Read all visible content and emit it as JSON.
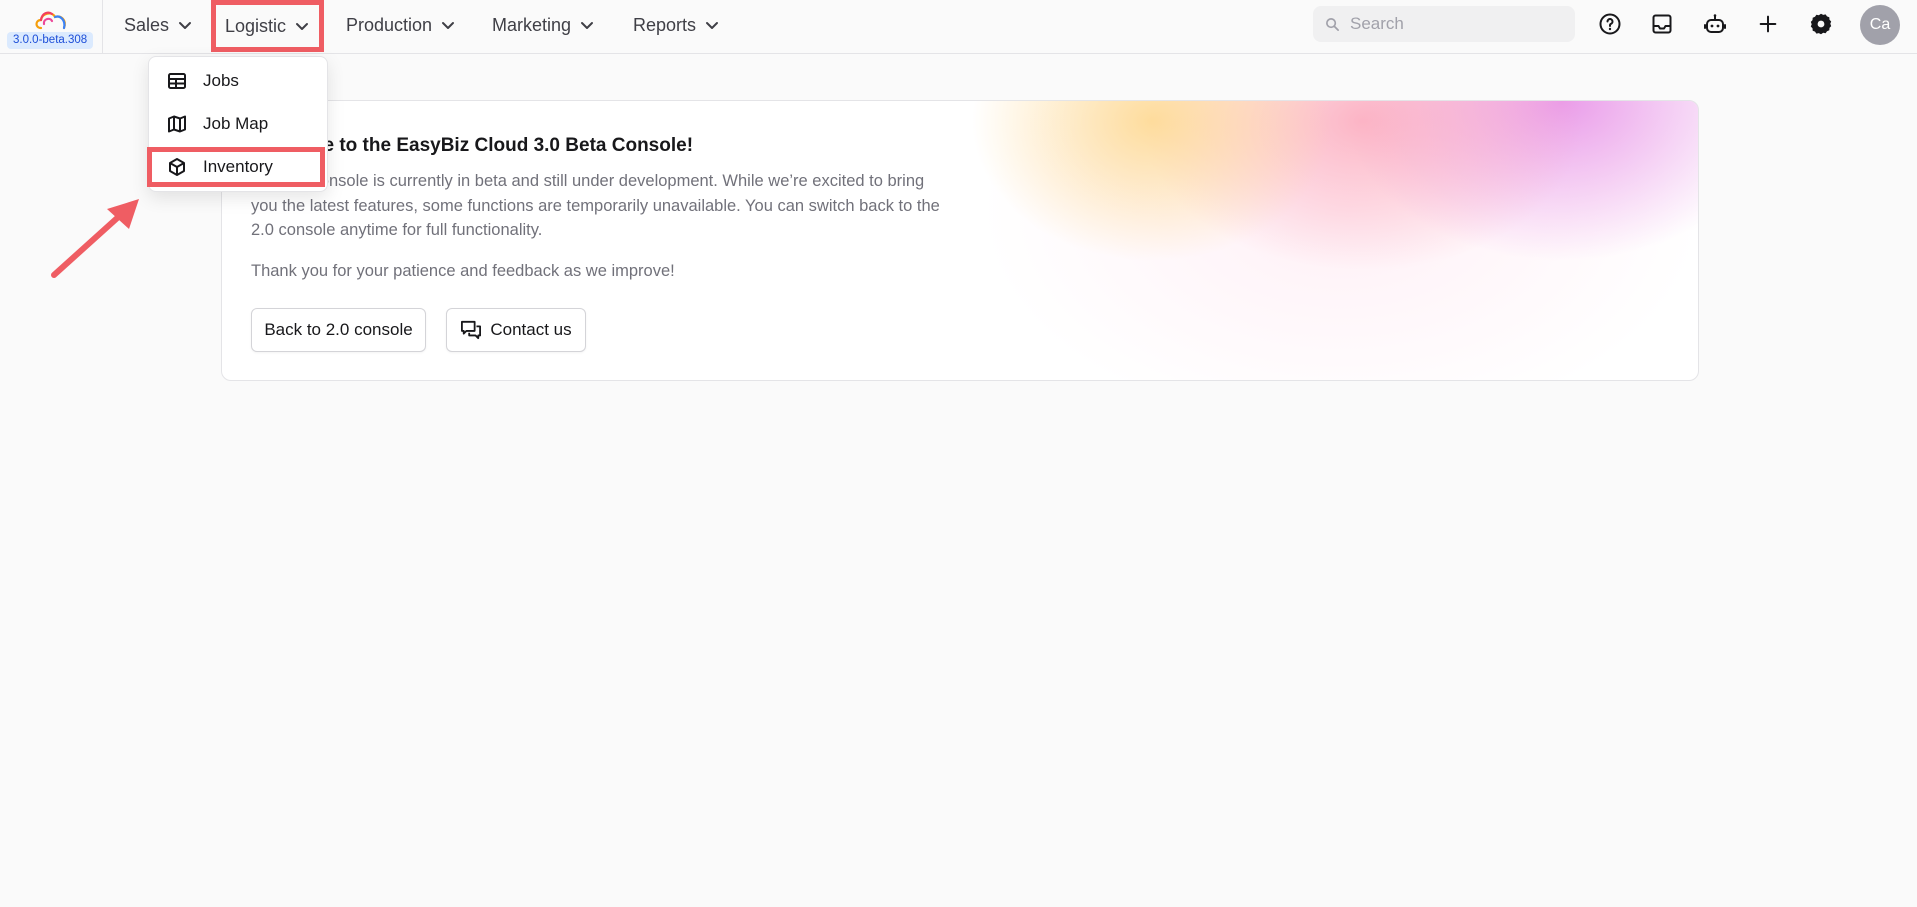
{
  "app": {
    "version": "3.0.0-beta.308"
  },
  "nav": {
    "items": [
      {
        "label": "Sales"
      },
      {
        "label": "Logistic"
      },
      {
        "label": "Production"
      },
      {
        "label": "Marketing"
      },
      {
        "label": "Reports"
      }
    ]
  },
  "search": {
    "placeholder": "Search",
    "value": ""
  },
  "toolbar": {
    "icons": [
      "help-icon",
      "inbox-icon",
      "ai-assistant-icon",
      "plus-icon",
      "settings-icon"
    ]
  },
  "user": {
    "initials": "Ca"
  },
  "logistic_menu": {
    "items": [
      {
        "label": "Jobs",
        "icon": "table-icon"
      },
      {
        "label": "Job Map",
        "icon": "map-icon"
      },
      {
        "label": "Inventory",
        "icon": "box-icon"
      }
    ]
  },
  "welcome": {
    "title": "Welcome to the EasyBiz Cloud 3.0 Beta Console!",
    "description": "The 3.0 console is currently in beta and still under development. While we’re excited to bring you the latest features, some functions are temporarily unavailable. You can switch back to the 2.0 console anytime for full functionality.",
    "thanks": "Thank you for your patience and feedback as we improve!",
    "back_button": "Back to 2.0 console",
    "contact_button": "Contact us"
  },
  "colors": {
    "highlight": "#ef5d63",
    "version_badge_bg": "#dbeafe",
    "version_badge_text": "#1d4ed8"
  }
}
